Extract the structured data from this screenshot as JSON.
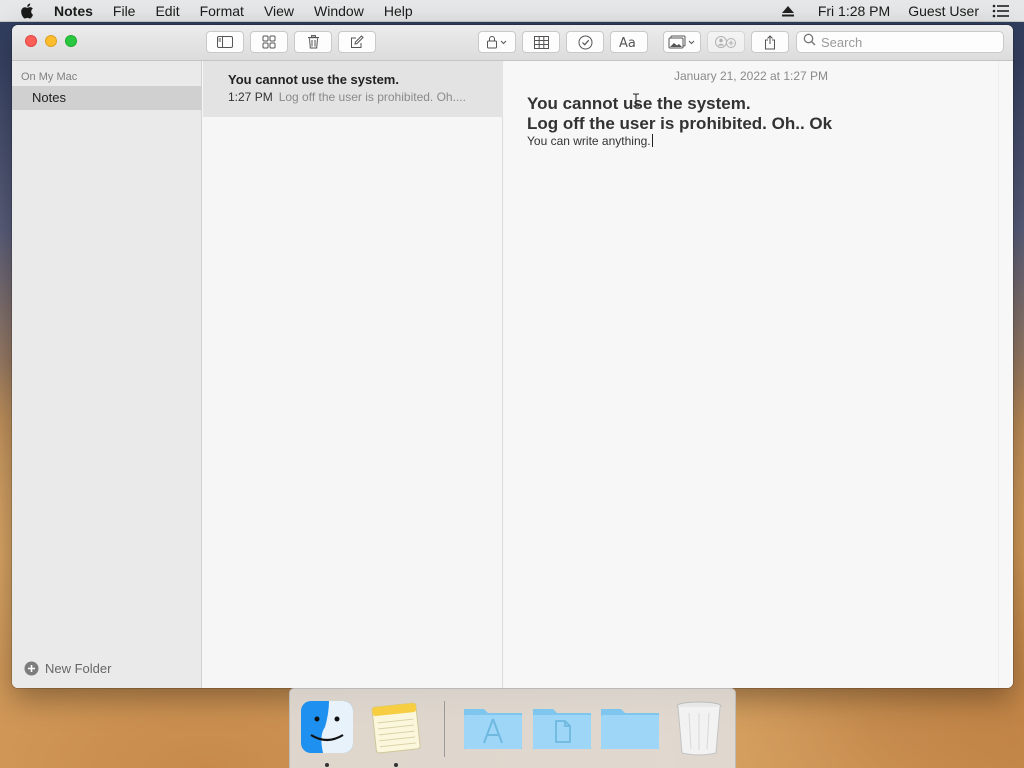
{
  "menubar": {
    "app_name": "Notes",
    "items": [
      "File",
      "Edit",
      "Format",
      "View",
      "Window",
      "Help"
    ],
    "clock": "Fri 1:28 PM",
    "user": "Guest User"
  },
  "toolbar": {
    "search_placeholder": "Search"
  },
  "sidebar": {
    "section_title": "On My Mac",
    "folder_label": "Notes",
    "new_folder_label": "New Folder"
  },
  "note_list": {
    "items": [
      {
        "title": "You cannot use the system.",
        "time": "1:27 PM",
        "snippet": "Log off the user is prohibited. Oh...."
      }
    ]
  },
  "editor": {
    "date": "January 21, 2022 at 1:27 PM",
    "heading_line1": "You cannot use the system.",
    "heading_line2": "Log off the user is prohibited. Oh.. Ok",
    "body": "You can write anything."
  },
  "dock": {
    "items": [
      "finder-icon",
      "notes-app-icon",
      "applications-folder-icon",
      "documents-folder-icon",
      "downloads-folder-icon",
      "trash-icon"
    ]
  },
  "colors": {
    "close": "#fc5f57",
    "minimize": "#fdbc2e",
    "maximize": "#29c840",
    "selection": "#d0d0d0",
    "folder_blue": "#8fd1f5"
  }
}
